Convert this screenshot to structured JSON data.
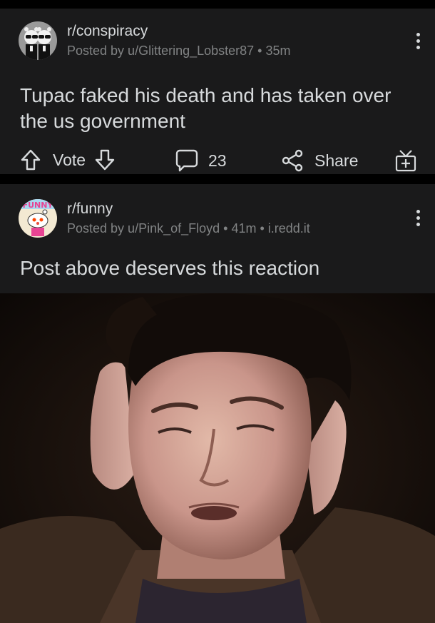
{
  "posts": [
    {
      "subreddit": "r/conspiracy",
      "posted_by": "Posted by u/Glittering_Lobster87",
      "age": "35m",
      "title": "Tupac faked his death and has taken over the us government",
      "vote_label": "Vote",
      "comment_count": "23",
      "share_label": "Share"
    },
    {
      "subreddit": "r/funny",
      "posted_by": "Posted by u/Pink_of_Floyd",
      "age": "41m",
      "domain": "i.redd.it",
      "title": "Post above deserves this reaction"
    }
  ],
  "icons": {
    "upvote": "arrow-up-icon",
    "downvote": "arrow-down-icon",
    "comment": "comment-bubble-icon",
    "share": "share-icon",
    "award": "gift-icon",
    "overflow": "kebab-menu-icon"
  },
  "colors": {
    "background": "#000000",
    "card": "#1a1a1b",
    "text": "#d7dadc",
    "meta": "#818384"
  }
}
